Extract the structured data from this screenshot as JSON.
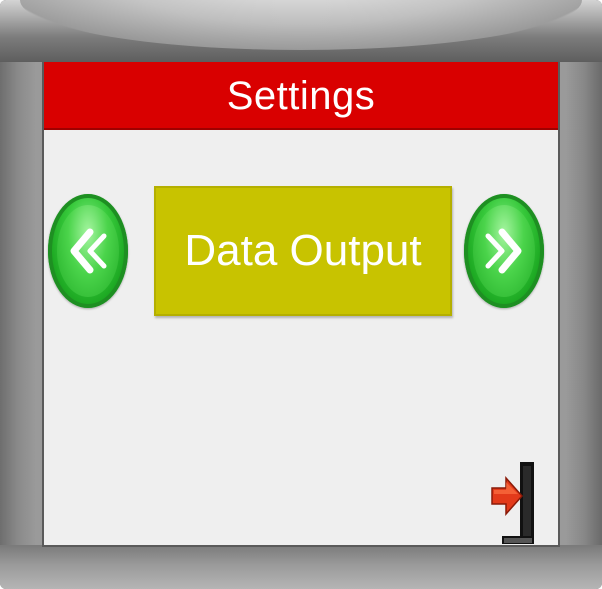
{
  "header": {
    "title": "Settings"
  },
  "menu": {
    "current_option": "Data Output"
  },
  "icons": {
    "prev": "double-chevron-left-icon",
    "next": "double-chevron-right-icon",
    "exit": "exit-door-icon"
  },
  "colors": {
    "title_bar": "#d90000",
    "option_box": "#c8c300",
    "nav_button": "#2db832",
    "screen_background": "#efefef"
  }
}
